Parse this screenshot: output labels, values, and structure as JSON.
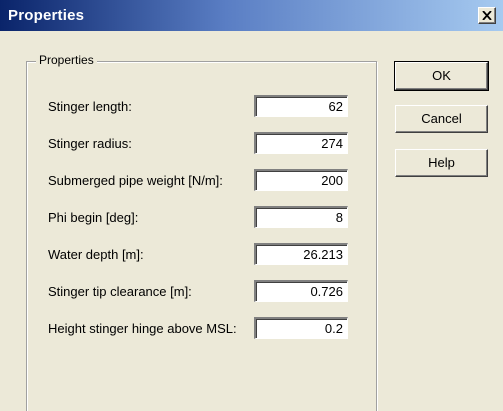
{
  "window": {
    "title": "Properties"
  },
  "group": {
    "label": "Properties"
  },
  "fields": [
    {
      "label": "Stinger length:",
      "value": "62"
    },
    {
      "label": "Stinger radius:",
      "value": "274"
    },
    {
      "label": "Submerged pipe weight [N/m]:",
      "value": "200"
    },
    {
      "label": "Phi begin [deg]:",
      "value": "8"
    },
    {
      "label": "Water depth [m]:",
      "value": "26.213"
    },
    {
      "label": "Stinger tip clearance [m]:",
      "value": "0.726"
    },
    {
      "label": "Height stinger hinge above MSL:",
      "value": "0.2"
    }
  ],
  "buttons": {
    "ok": "OK",
    "cancel": "Cancel",
    "help": "Help"
  },
  "colors": {
    "titlebar_start": "#0a246a",
    "titlebar_end": "#a6caf0",
    "face": "#ece9d8"
  },
  "icons": {
    "close": "close-icon"
  }
}
